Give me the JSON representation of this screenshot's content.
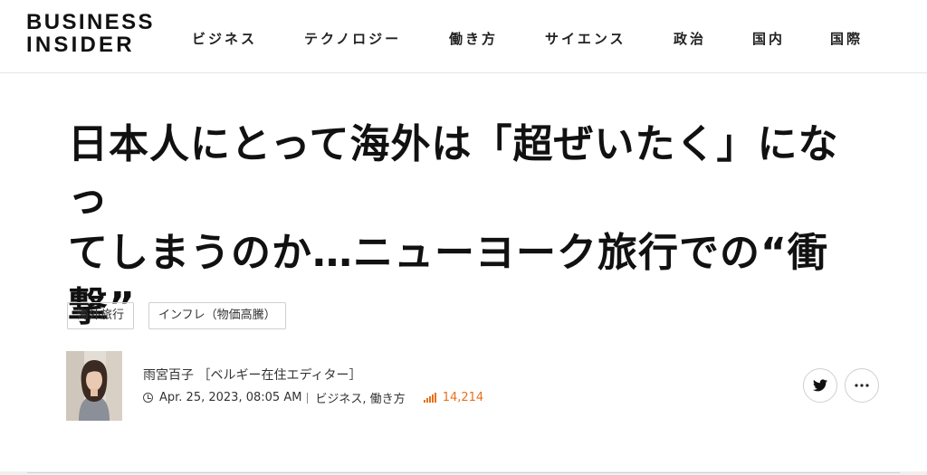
{
  "brand": {
    "line1": "BUSINESS",
    "line2": "INSIDER"
  },
  "nav": {
    "items": [
      "ビジネス",
      "テクノロジー",
      "働き方",
      "サイエンス",
      "政治",
      "国内",
      "国際"
    ]
  },
  "article": {
    "title_line1": "日本人にとって海外は「超ぜいたく」になっ",
    "title_line2": "てしまうのか…ニューヨーク旅行での“衝",
    "title_line3": "撃”",
    "tags": [
      "海外旅行",
      "インフレ（物価高騰）"
    ],
    "author": "雨宮百子 ［ベルギー在住エディター］",
    "date": "Apr. 25, 2023, 08:05 AM",
    "categories": "ビジネス, 働き方",
    "views": "14,214"
  },
  "colors": {
    "accent": "#e8701a",
    "text": "#111111",
    "border": "#cfcfcf"
  },
  "icons": {
    "share_twitter": "twitter-icon",
    "more": "more-icon",
    "date": "clock-icon",
    "views": "bar-chart-icon"
  }
}
